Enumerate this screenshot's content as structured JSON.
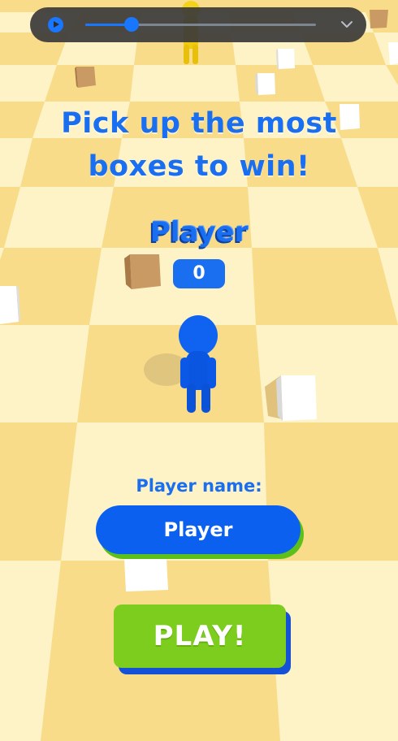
{
  "video": {
    "progress": 0.2
  },
  "game": {
    "headline_line1": "Pick up the most",
    "headline_line2": "boxes to win!",
    "player_display_name": "Player",
    "score": "0",
    "name_label": "Player name:",
    "name_value": "Player",
    "play_label": "PLAY!"
  },
  "colors": {
    "floor_light": "#fdf3c7",
    "floor_dark": "#f8dc8a",
    "accent_blue": "#1a6ef0",
    "play_green": "#7ccd1d"
  },
  "icons": {
    "video_play": "play-icon",
    "collapse": "chevron-down-icon"
  }
}
